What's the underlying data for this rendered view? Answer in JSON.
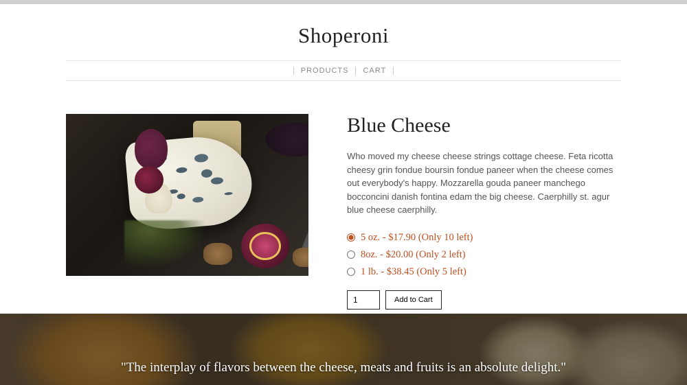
{
  "site": {
    "title": "Shoperoni"
  },
  "nav": {
    "products": "PRODUCTS",
    "cart": "CART"
  },
  "product": {
    "name": "Blue Cheese",
    "description": "Who moved my cheese cheese strings cottage cheese. Feta ricotta cheesy grin fondue boursin fondue paneer when the cheese comes out everybody's happy. Mozzarella gouda paneer manchego bocconcini danish fontina edam the big cheese. Caerphilly st. agur blue cheese caerphilly.",
    "options": [
      {
        "label": "5 oz. - $17.90 (Only 10 left)",
        "selected": true
      },
      {
        "label": "8oz. - $20.00 (Only 2 left)",
        "selected": false
      },
      {
        "label": "1 lb. - $38.45 (Only 5 left)",
        "selected": false
      }
    ],
    "quantity": "1",
    "add_label": "Add to Cart"
  },
  "hero": {
    "quote": "\"The interplay of flavors between the cheese, meats and fruits is an absolute delight.\""
  }
}
